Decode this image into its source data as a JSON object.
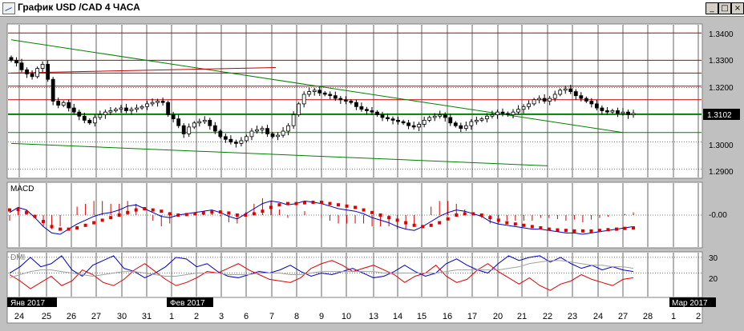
{
  "window": {
    "title": "График USD /CAD  4 ЧАСА",
    "minimize_glyph": "_",
    "maximize_glyph": "□",
    "close_glyph": "×"
  },
  "colors": {
    "background": "#ffffff",
    "grid": "#000000",
    "candle": "#000000",
    "trendline": "#008000",
    "resistance": "#c00000",
    "macd_line": "#0000c0",
    "macd_signal": "#e00000",
    "dmi_plus": "#0000c0",
    "dmi_minus": "#e00000",
    "adx": "#a0a0a0"
  },
  "price_panel": {
    "current_price": "1.3102",
    "y_ticks": [
      "1.3400",
      "1.3300",
      "1.3200",
      "1.3000",
      "1.2900"
    ]
  },
  "macd_panel": {
    "label": "MACD",
    "y_ticks": [
      "-0.00"
    ]
  },
  "dmi_panel": {
    "label": "DMI",
    "y_ticks": [
      "30",
      "20"
    ]
  },
  "x_axis": {
    "month_labels": [
      "Янв 2017",
      "Фев 2017",
      "Мар 2017"
    ],
    "day_labels": [
      "24",
      "25",
      "26",
      "27",
      "30",
      "31",
      "1",
      "2",
      "3",
      "6",
      "7",
      "8",
      "9",
      "10",
      "13",
      "14",
      "15",
      "16",
      "17",
      "20",
      "21",
      "22",
      "23",
      "24",
      "27",
      "28",
      "1",
      "2"
    ]
  },
  "chart_data": [
    {
      "type": "candlestick",
      "title": "USD/CAD",
      "ylim": [
        1.287,
        1.343
      ],
      "y_ticks": [
        1.34,
        1.33,
        1.32,
        1.3,
        1.29
      ],
      "horizontal_levels": [
        {
          "value": 1.34,
          "color": "#c00000"
        },
        {
          "value": 1.33,
          "color": "#c00000"
        },
        {
          "value": 1.3253,
          "color": "#c00000"
        },
        {
          "value": 1.3205,
          "color": "#c00000"
        },
        {
          "value": 1.3155,
          "color": "#c00000"
        },
        {
          "value": 1.3102,
          "color": "#008000",
          "bold": true
        },
        {
          "value": 1.3035,
          "color": "#008000"
        }
      ],
      "trendlines": [
        {
          "from": [
            "24",
            1.3375
          ],
          "to": [
            "23",
            1.3035
          ],
          "color": "#008000"
        },
        {
          "from": [
            "24",
            1.2995
          ],
          "to": [
            "22",
            1.2913
          ],
          "color": "#008000"
        },
        {
          "from": [
            "24",
            1.3253
          ],
          "to": [
            "7",
            1.3273
          ],
          "color": "#c00000"
        }
      ],
      "closes": [
        1.33,
        1.329,
        1.3265,
        1.325,
        1.324,
        1.327,
        1.3285,
        1.323,
        1.315,
        1.3135,
        1.3145,
        1.3125,
        1.311,
        1.3095,
        1.308,
        1.307,
        1.309,
        1.31,
        1.311,
        1.3115,
        1.312,
        1.3125,
        1.3115,
        1.312,
        1.3125,
        1.313,
        1.314,
        1.3145,
        1.315,
        1.3145,
        1.31,
        1.3085,
        1.306,
        1.303,
        1.3055,
        1.307,
        1.3075,
        1.308,
        1.306,
        1.304,
        1.302,
        1.301,
        1.3,
        1.2995,
        1.3005,
        1.302,
        1.304,
        1.3045,
        1.305,
        1.303,
        1.302,
        1.3025,
        1.304,
        1.306,
        1.31,
        1.314,
        1.3175,
        1.3185,
        1.319,
        1.318,
        1.3175,
        1.317,
        1.316,
        1.3155,
        1.315,
        1.3145,
        1.313,
        1.312,
        1.3115,
        1.311,
        1.31,
        1.309,
        1.3085,
        1.308,
        1.3075,
        1.307,
        1.306,
        1.3055,
        1.3065,
        1.308,
        1.309,
        1.3095,
        1.31,
        1.309,
        1.307,
        1.306,
        1.305,
        1.306,
        1.3075,
        1.308,
        1.3085,
        1.3095,
        1.31,
        1.311,
        1.3105,
        1.31,
        1.311,
        1.312,
        1.313,
        1.314,
        1.3155,
        1.316,
        1.315,
        1.316,
        1.3175,
        1.319,
        1.3195,
        1.3185,
        1.317,
        1.316,
        1.315,
        1.314,
        1.3125,
        1.3115,
        1.311,
        1.3115,
        1.3105,
        1.311,
        1.31,
        1.3105
      ]
    },
    {
      "type": "line",
      "title": "MACD",
      "series": [
        {
          "values": [
            0.1,
            0.3,
            0.2,
            -0.1,
            -0.45,
            -0.7,
            -0.75,
            -0.55,
            -0.35,
            -0.2,
            -0.05,
            0.05,
            0.1,
            0.2,
            0.35,
            0.4,
            0.25,
            0.1,
            -0.05,
            -0.1,
            0.0,
            0.05,
            0.1,
            0.15,
            0.2,
            0.1,
            -0.05,
            -0.15,
            0.05,
            0.25,
            0.45,
            0.55,
            0.5,
            0.4,
            0.45,
            0.55,
            0.5,
            0.45,
            0.35,
            0.25,
            0.2,
            0.15,
            0.05,
            -0.1,
            -0.2,
            -0.3,
            -0.45,
            -0.55,
            -0.6,
            -0.45,
            -0.25,
            -0.05,
            0.1,
            0.2,
            0.15,
            0.05,
            -0.05,
            -0.25,
            -0.35,
            -0.4,
            -0.45,
            -0.5,
            -0.55,
            -0.55,
            -0.6,
            -0.65,
            -0.7,
            -0.7,
            -0.75,
            -0.7,
            -0.65,
            -0.6,
            -0.55,
            -0.5,
            -0.45
          ]
        },
        {
          "values": [
            0.2,
            0.22,
            0.1,
            -0.05,
            -0.25,
            -0.45,
            -0.55,
            -0.55,
            -0.5,
            -0.4,
            -0.3,
            -0.2,
            -0.1,
            0.0,
            0.1,
            0.2,
            0.25,
            0.2,
            0.15,
            0.05,
            0.0,
            0.02,
            0.05,
            0.08,
            0.12,
            0.12,
            0.08,
            0.0,
            0.0,
            0.05,
            0.15,
            0.3,
            0.4,
            0.45,
            0.45,
            0.48,
            0.5,
            0.5,
            0.45,
            0.4,
            0.35,
            0.3,
            0.2,
            0.1,
            0.0,
            -0.1,
            -0.2,
            -0.3,
            -0.4,
            -0.45,
            -0.4,
            -0.3,
            -0.15,
            0.0,
            0.05,
            0.05,
            0.0,
            -0.1,
            -0.2,
            -0.3,
            -0.35,
            -0.4,
            -0.45,
            -0.5,
            -0.55,
            -0.58,
            -0.6,
            -0.62,
            -0.62,
            -0.62,
            -0.6,
            -0.57,
            -0.55,
            -0.52,
            -0.5
          ]
        }
      ]
    },
    {
      "type": "line",
      "title": "DMI",
      "ylim": [
        5,
        33
      ],
      "series": [
        {
          "values": [
            20,
            24,
            30,
            24,
            26,
            31,
            22,
            18,
            25,
            28,
            31,
            23,
            21,
            17,
            20,
            24,
            30,
            29,
            24,
            26,
            21,
            18,
            17,
            19,
            21,
            20,
            22,
            25,
            21,
            18,
            20,
            19,
            21,
            23,
            20,
            17,
            18,
            21,
            25,
            21,
            18,
            20,
            26,
            29,
            25,
            22,
            20,
            26,
            31,
            28,
            30,
            31,
            27,
            30,
            26,
            23,
            25,
            22,
            24,
            22,
            21
          ]
        },
        {
          "values": [
            19,
            15,
            10,
            14,
            18,
            12,
            15,
            22,
            19,
            14,
            12,
            16,
            22,
            26,
            21,
            16,
            12,
            14,
            17,
            21,
            20,
            23,
            26,
            22,
            19,
            16,
            15,
            14,
            17,
            23,
            26,
            28,
            25,
            21,
            23,
            25,
            22,
            19,
            14,
            18,
            20,
            25,
            18,
            14,
            16,
            22,
            26,
            21,
            17,
            13,
            17,
            12,
            9,
            13,
            15,
            19,
            16,
            14,
            12,
            16,
            17
          ]
        },
        {
          "values": [
            17,
            19,
            21,
            22,
            22,
            21,
            20,
            19,
            18,
            19,
            20,
            21,
            21,
            20,
            19,
            18,
            18,
            19,
            20,
            20,
            20,
            19,
            19,
            19,
            20,
            20,
            20,
            19,
            19,
            20,
            21,
            21,
            21,
            21,
            21,
            21,
            20,
            20,
            20,
            20,
            20,
            20,
            21,
            22,
            22,
            22,
            22,
            22,
            23,
            24,
            26,
            27,
            28,
            28,
            27,
            26,
            25,
            25,
            24,
            24,
            23
          ]
        }
      ]
    }
  ]
}
